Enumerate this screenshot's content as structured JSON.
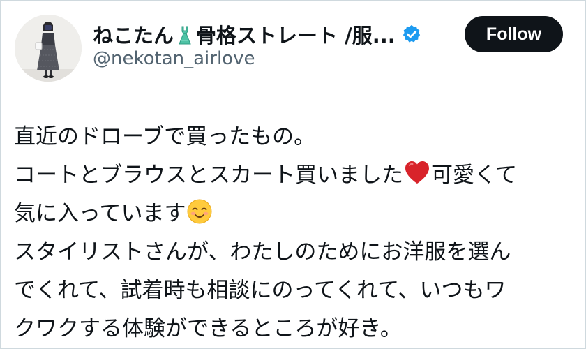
{
  "author": {
    "display_name": "ねこたん👗骨格ストレート /服...",
    "display_name_text": "ねこたん",
    "display_name_rest": "骨格ストレート /服...",
    "handle": "@nekotan_airlove",
    "verified": true,
    "icons": [
      "dress-emoji-icon",
      "verified-badge-icon"
    ]
  },
  "follow_button": {
    "label": "Follow"
  },
  "tweet": {
    "lines": [
      "直近のドローブで買ったもの。",
      "コートとブラウスとスカート買いました",
      "可愛くて",
      "気に入っています",
      "スタイリストさんが、わたしのためにお洋服を選ん",
      "でくれて、試着時も相談にのってくれて、いつもワ",
      "クワクする体験ができるところが好き。"
    ],
    "emojis": [
      "red-heart-emoji",
      "smiling-face-emoji"
    ]
  },
  "colors": {
    "text": "#0f1419",
    "secondary_text": "#536471",
    "button_bg": "#0f1419",
    "button_text": "#ffffff",
    "verified_blue": "#1d9bf0",
    "heart_red": "#d8232a",
    "border": "#cfd9de"
  }
}
